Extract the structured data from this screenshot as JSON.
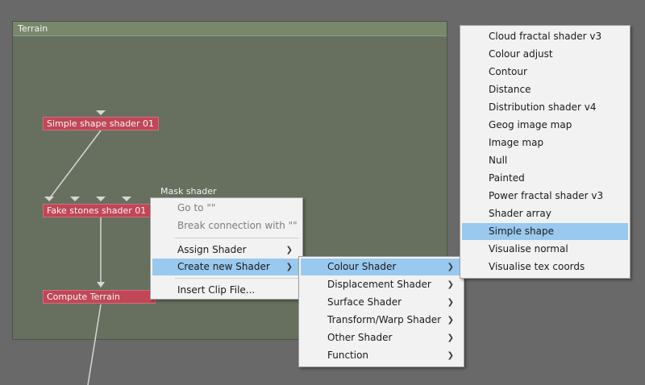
{
  "group": {
    "title": "Terrain"
  },
  "nodes": {
    "simple_shape": "Simple shape shader 01",
    "fake_stones": "Fake stones shader 01",
    "compute_terrain": "Compute Terrain"
  },
  "floating_label": "Mask shader",
  "context_menu": {
    "go_to": "Go to \"\"",
    "break_connection": "Break connection with \"\"",
    "assign_shader": "Assign Shader",
    "create_new_shader": "Create new Shader",
    "insert_clip_file": "Insert Clip File..."
  },
  "shader_menu": {
    "colour": "Colour Shader",
    "displacement": "Displacement Shader",
    "surface": "Surface Shader",
    "transform_warp": "Transform/Warp Shader",
    "other": "Other Shader",
    "function": "Function"
  },
  "colour_menu": {
    "items": [
      "Cloud fractal shader v3",
      "Colour adjust",
      "Contour",
      "Distance",
      "Distribution shader v4",
      "Geog image map",
      "Image map",
      "Null",
      "Painted",
      "Power fractal shader v3",
      "Shader array",
      "Simple shape",
      "Visualise normal",
      "Visualise tex coords"
    ],
    "highlighted": "Simple shape"
  },
  "colors": {
    "background": "#696969",
    "group_bg": "#67705f",
    "group_header": "#79876b",
    "node": "#c04757",
    "menu_bg": "#f2f2f2",
    "menu_highlight": "#99c9ef"
  }
}
